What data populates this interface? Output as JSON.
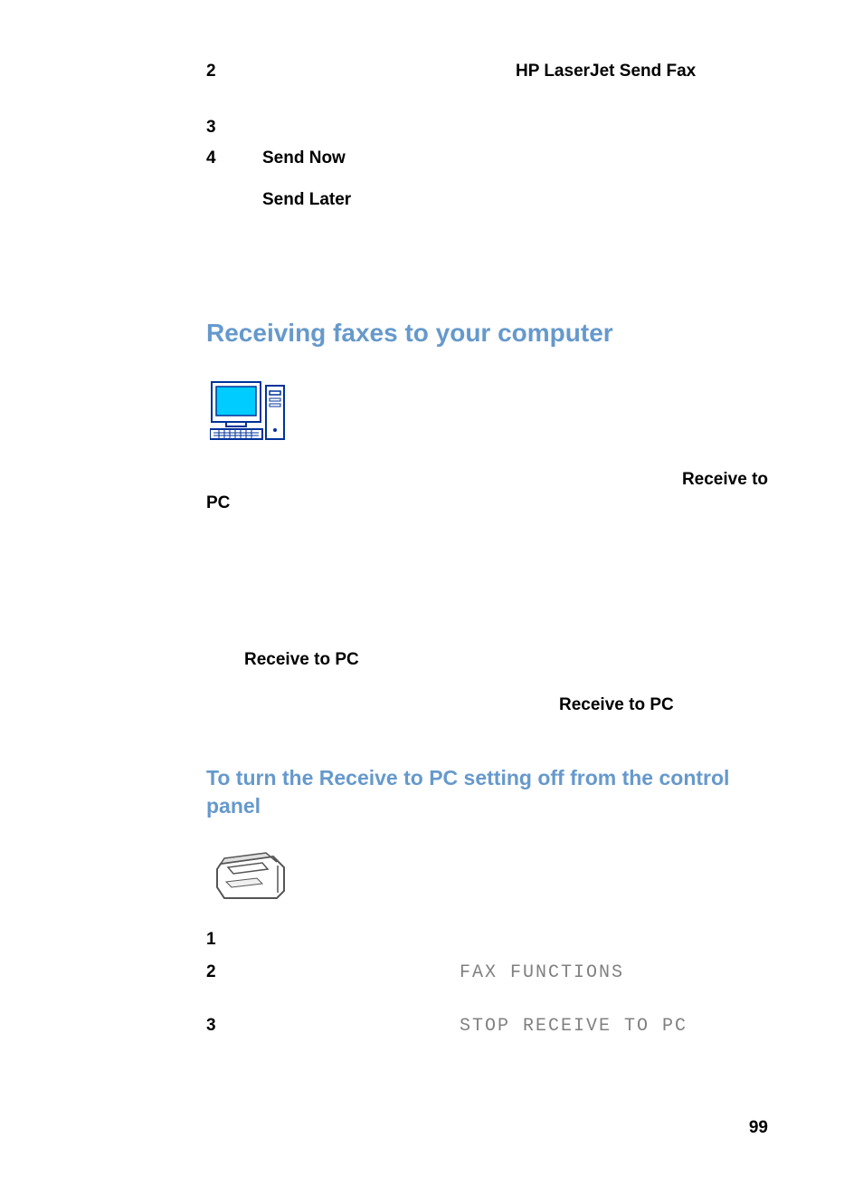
{
  "top_steps": {
    "n2": "2",
    "n3": "3",
    "n4": "4",
    "hp_laserjet": "HP LaserJet Send Fax",
    "send_now": "Send Now",
    "send_later": "Send Later"
  },
  "heading1": "Receiving faxes to your computer",
  "receive_to": "Receive to",
  "pc": "PC",
  "receive_to_pc_1": "Receive to PC",
  "receive_to_pc_2": "Receive to PC",
  "heading2": "To turn the Receive to PC setting off from the control panel",
  "lower_steps": {
    "n1": "1",
    "n2": "2",
    "n3": "3",
    "fax_functions": "FAX FUNCTIONS",
    "stop_receive": "STOP RECEIVE TO PC"
  },
  "page_number": "99"
}
